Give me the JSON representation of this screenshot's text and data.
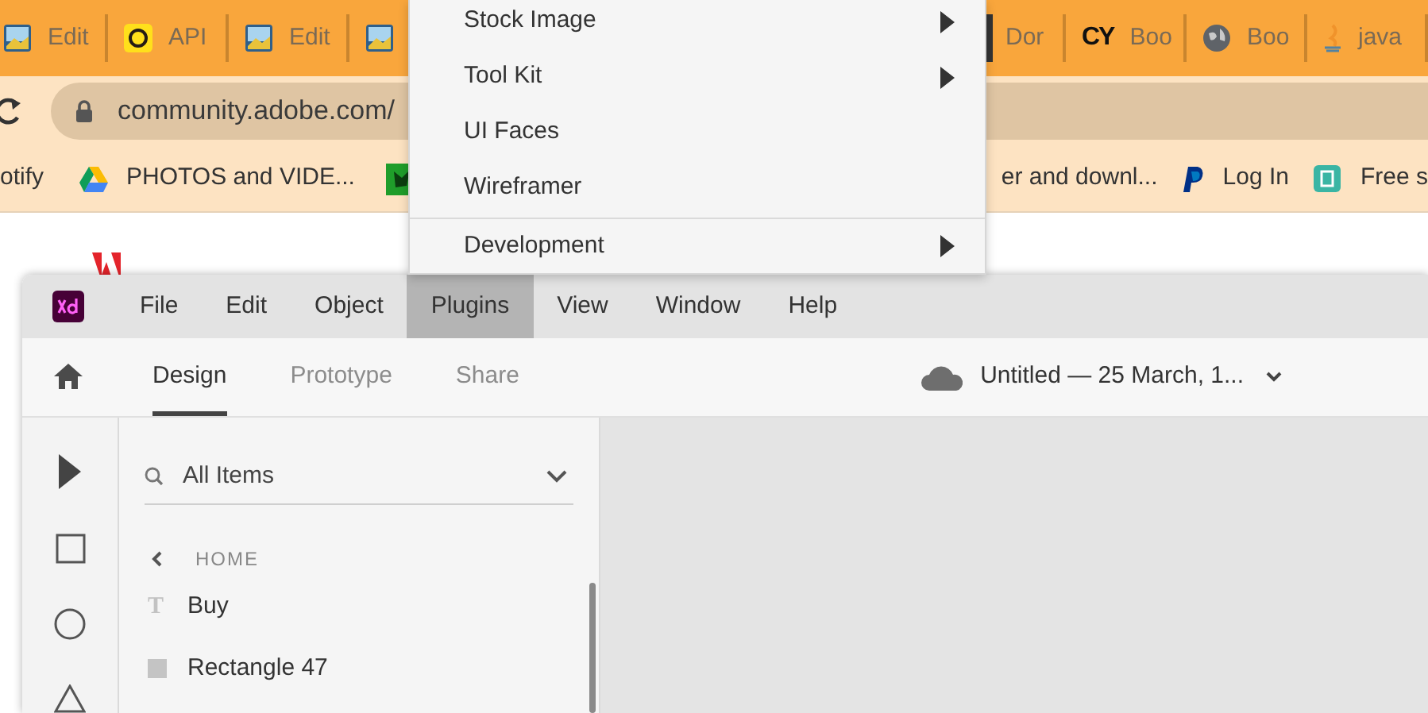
{
  "browser": {
    "tabs": [
      {
        "title": "Edit"
      },
      {
        "title": "API"
      },
      {
        "title": "Edit"
      },
      {
        "title": "Dor"
      },
      {
        "title": "Boo",
        "badge": "CY"
      },
      {
        "title": "Boo"
      },
      {
        "title": "java"
      }
    ],
    "address": "community.adobe.com/",
    "bookmarks": [
      {
        "label": "otify"
      },
      {
        "label": "PHOTOS and VIDE..."
      },
      {
        "label": "er and downl..."
      },
      {
        "label": "Log In"
      },
      {
        "label": "Free s"
      }
    ]
  },
  "xd": {
    "menu_bar": [
      {
        "label": "File",
        "selected": false
      },
      {
        "label": "Edit",
        "selected": false
      },
      {
        "label": "Object",
        "selected": false
      },
      {
        "label": "Plugins",
        "selected": true
      },
      {
        "label": "View",
        "selected": false
      },
      {
        "label": "Window",
        "selected": false
      },
      {
        "label": "Help",
        "selected": false
      }
    ],
    "mode_tabs": [
      {
        "label": "Design",
        "selected": true
      },
      {
        "label": "Prototype",
        "selected": false
      },
      {
        "label": "Share",
        "selected": false
      }
    ],
    "document_title": "Untitled — 25 March, 1...",
    "layers": {
      "filter": "All Items",
      "breadcrumb": "HOME",
      "items": [
        {
          "kind": "text",
          "glyph": "T",
          "name": "Buy"
        },
        {
          "kind": "rectangle",
          "name": "Rectangle 47"
        }
      ]
    }
  },
  "plugins_menu": [
    {
      "label": "Stock Image",
      "submenu": true,
      "divider_above": false
    },
    {
      "label": "Tool Kit",
      "submenu": true,
      "divider_above": false
    },
    {
      "label": "UI Faces",
      "submenu": false,
      "divider_above": false
    },
    {
      "label": "Wireframer",
      "submenu": false,
      "divider_above": false
    },
    {
      "label": "Development",
      "submenu": true,
      "divider_above": true
    }
  ]
}
